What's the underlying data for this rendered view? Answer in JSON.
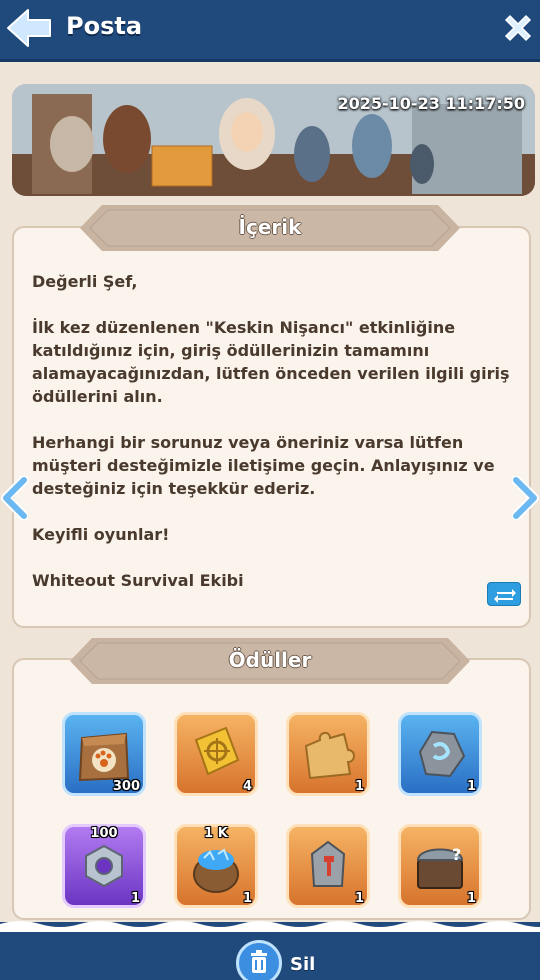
{
  "header": {
    "title": "Posta"
  },
  "banner": {
    "timestamp": "2025-10-23 11:17:50"
  },
  "content_section": {
    "label": "İçerik",
    "paragraphs": [
      "Değerli Şef,",
      "İlk kez düzenlenen \"Keskin Nişancı\" etkinliğine katıldığınız için, giriş ödüllerinizin tamamını alamayacağınızdan, lütfen önceden verilen ilgili giriş ödüllerini alın.",
      "Herhangi bir sorunuz veya öneriniz varsa lütfen müşteri desteğimizle iletişime geçin. Anlayışınız ve desteğiniz için teşekkür ederiz.",
      "Keyifli oyunlar!",
      "Whiteout Survival Ekibi"
    ]
  },
  "rewards_section": {
    "label": "Ödüller",
    "items": [
      {
        "icon": "pet-food-bag-icon",
        "count": "300",
        "top_label": "",
        "frame": "blue"
      },
      {
        "icon": "golden-ticket-icon",
        "count": "4",
        "top_label": "",
        "frame": "orange"
      },
      {
        "icon": "puzzle-piece-icon",
        "count": "1",
        "top_label": "",
        "frame": "orange"
      },
      {
        "icon": "blue-gem-stone-icon",
        "count": "1",
        "top_label": "",
        "frame": "blue"
      },
      {
        "icon": "hex-nut-icon",
        "count": "1",
        "top_label": "100",
        "frame": "purple"
      },
      {
        "icon": "crystal-sack-icon",
        "count": "1",
        "top_label": "1 K",
        "frame": "orange"
      },
      {
        "icon": "hammer-stone-icon",
        "count": "1",
        "top_label": "",
        "frame": "orange"
      },
      {
        "icon": "mystery-chest-icon",
        "count": "1",
        "top_label": "",
        "frame": "orange"
      }
    ]
  },
  "footer": {
    "delete_label": "Sil"
  },
  "colors": {
    "header_bg": "#20497c",
    "panel_bg": "#fbf4ec",
    "page_bg": "#efe4d8",
    "tab_bg": "#c9b4a2",
    "text": "#4a3a2e"
  }
}
